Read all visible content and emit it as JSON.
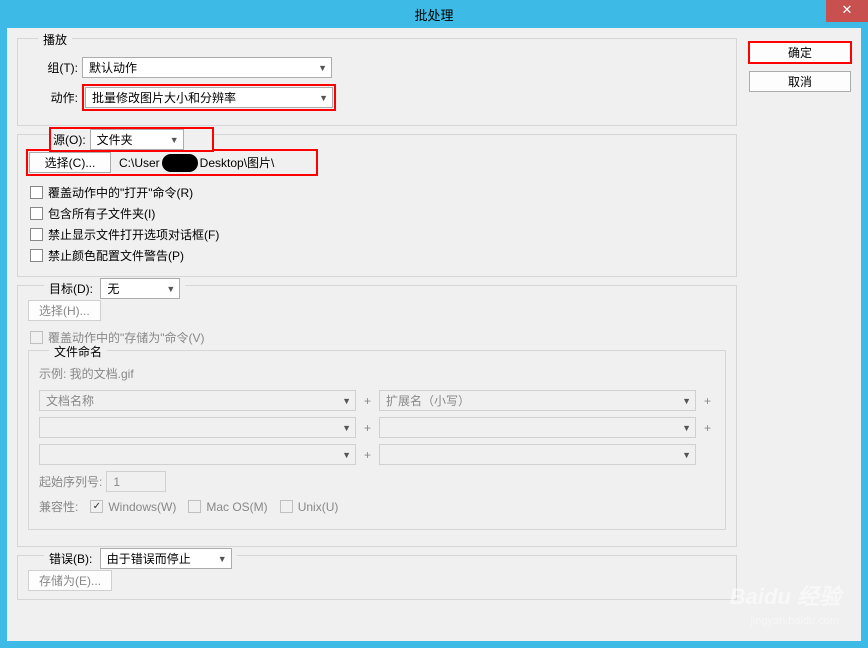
{
  "window": {
    "title": "批处理",
    "close": "✕"
  },
  "buttons": {
    "ok": "确定",
    "cancel": "取消"
  },
  "play": {
    "legend": "播放",
    "group_label": "组(T):",
    "group_value": "默认动作",
    "action_label": "动作:",
    "action_value": "批量修改图片大小和分辨率"
  },
  "source": {
    "label": "源(O):",
    "value": "文件夹",
    "choose_btn": "选择(C)...",
    "path_part1": "C:\\User",
    "path_part2": "Desktop\\图片\\",
    "cb1": "覆盖动作中的\"打开\"命令(R)",
    "cb2": "包含所有子文件夹(I)",
    "cb3": "禁止显示文件打开选项对话框(F)",
    "cb4": "禁止颜色配置文件警告(P)"
  },
  "dest": {
    "label": "目标(D):",
    "value": "无",
    "choose_btn": "选择(H)...",
    "override_cb": "覆盖动作中的\"存储为\"命令(V)"
  },
  "naming": {
    "legend": "文件命名",
    "example": "示例: 我的文档.gif",
    "f1": "文档名称",
    "f2": "扩展名（小写）",
    "start_label": "起始序列号:",
    "start_value": "1",
    "compat_label": "兼容性:",
    "compat_win": "Windows(W)",
    "compat_mac": "Mac OS(M)",
    "compat_unix": "Unix(U)"
  },
  "error": {
    "label": "错误(B):",
    "value": "由于错误而停止",
    "save_as": "存储为(E)..."
  },
  "watermark": {
    "main": "Baidu 经验",
    "sub": "jingyan.baidu.com"
  }
}
